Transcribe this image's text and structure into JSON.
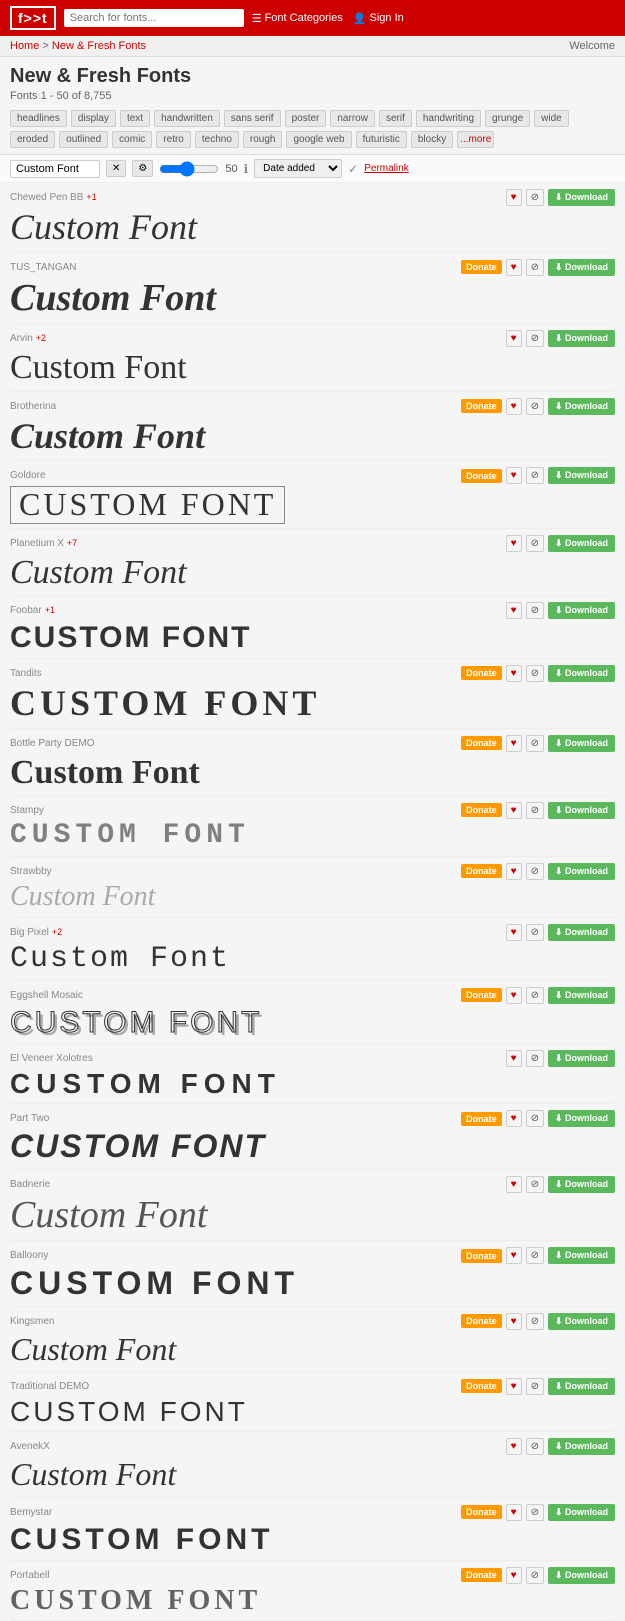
{
  "header": {
    "logo": "f>>t",
    "search_placeholder": "Search for fonts...",
    "nav": [
      {
        "label": "Font Categories",
        "icon": "menu-icon"
      },
      {
        "label": "Sign In",
        "icon": "user-icon"
      }
    ]
  },
  "breadcrumb": {
    "home": "Home",
    "section": "New & Fresh Fonts",
    "welcome": "Welcome"
  },
  "page": {
    "title": "New & Fresh Fonts",
    "subtitle": "Fonts 1 - 50 of 8,755"
  },
  "tags": [
    {
      "label": "headlines",
      "active": false
    },
    {
      "label": "display",
      "active": false
    },
    {
      "label": "text",
      "active": false
    },
    {
      "label": "handwritten",
      "active": false
    },
    {
      "label": "sans serif",
      "active": false
    },
    {
      "label": "poster",
      "active": false
    },
    {
      "label": "narrow",
      "active": false
    },
    {
      "label": "serif",
      "active": false
    },
    {
      "label": "handwriting",
      "active": false
    },
    {
      "label": "grunge",
      "active": false
    },
    {
      "label": "wide",
      "active": false
    },
    {
      "label": "eroded",
      "active": false
    },
    {
      "label": "outlined",
      "active": false
    },
    {
      "label": "comic",
      "active": false
    },
    {
      "label": "retro",
      "active": false
    },
    {
      "label": "techno",
      "active": false
    },
    {
      "label": "rough",
      "active": false
    },
    {
      "label": "google web",
      "active": false
    },
    {
      "label": "futuristic",
      "active": false
    },
    {
      "label": "blocky",
      "active": false
    },
    {
      "label": "...more",
      "active": false,
      "special": true
    }
  ],
  "controls": {
    "preview_text": "Custom Font",
    "size": "50",
    "sort": "Date added",
    "permalink": "Permalink"
  },
  "fonts": [
    {
      "name": "Chewed Pen BB",
      "variant": "+1",
      "preview": "Custom Font",
      "style": "chewed",
      "donate": false,
      "heart": true,
      "block": true
    },
    {
      "name": "TUS_TANGAN",
      "variant": "",
      "preview": "Custom Font",
      "style": "tangan",
      "donate": true,
      "heart": true,
      "block": true
    },
    {
      "name": "Arvin",
      "variant": "+2",
      "preview": "Custom Font",
      "style": "arvin",
      "donate": false,
      "heart": true,
      "block": true
    },
    {
      "name": "Brotherina",
      "variant": "",
      "preview": "Custom Font",
      "style": "brotherina",
      "donate": true,
      "heart": true,
      "block": true
    },
    {
      "name": "Goldore",
      "variant": "",
      "preview": "CUSTOM FONT",
      "style": "goldore",
      "donate": true,
      "heart": true,
      "block": true
    },
    {
      "name": "Planetium X",
      "variant": "+7",
      "preview": "Custom Font",
      "style": "planetium",
      "donate": false,
      "heart": true,
      "block": true
    },
    {
      "name": "Foobar",
      "variant": "+1",
      "preview": "CUSTOM FONT",
      "style": "foobar",
      "donate": false,
      "heart": true,
      "block": true
    },
    {
      "name": "Tandits",
      "variant": "",
      "preview": "CUSTOM FONT",
      "style": "tandits",
      "donate": true,
      "heart": true,
      "block": true
    },
    {
      "name": "Bottle Party DEMO",
      "variant": "",
      "preview": "Custom Font",
      "style": "bottleparty",
      "donate": true,
      "heart": true,
      "block": true
    },
    {
      "name": "Stampy",
      "variant": "",
      "preview": "CUSTOM FONT",
      "style": "stampy",
      "donate": true,
      "heart": true,
      "block": true
    },
    {
      "name": "Strawbby",
      "variant": "",
      "preview": "Custom Font",
      "style": "strawbby",
      "donate": true,
      "heart": true,
      "block": true
    },
    {
      "name": "Big Pixel",
      "variant": "+2",
      "preview": "Custom Font",
      "style": "bigpixel",
      "donate": false,
      "heart": true,
      "block": true
    },
    {
      "name": "Eggshell Mosaic",
      "variant": "",
      "preview": "CUSTOM FONT",
      "style": "eggshell",
      "donate": true,
      "heart": true,
      "block": true
    },
    {
      "name": "El Veneer Xolotres",
      "variant": "",
      "preview": "CUSTOM FONT",
      "style": "elvenin",
      "donate": false,
      "heart": true,
      "block": true
    },
    {
      "name": "Part Two",
      "variant": "",
      "preview": "CUSTOM FONT",
      "style": "parttwo",
      "donate": true,
      "heart": true,
      "block": true
    },
    {
      "name": "Badnerie",
      "variant": "",
      "preview": "Custom Font",
      "style": "badnerie",
      "donate": false,
      "heart": true,
      "block": true
    },
    {
      "name": "Balloony",
      "variant": "",
      "preview": "CUSTOM FONT",
      "style": "balloony",
      "donate": true,
      "heart": true,
      "block": true
    },
    {
      "name": "Kingsmen",
      "variant": "",
      "preview": "Custom Font",
      "style": "kingsmen",
      "donate": true,
      "heart": true,
      "block": true
    },
    {
      "name": "Traditional DEMO",
      "variant": "",
      "preview": "CUSTOM FONT",
      "style": "traditional",
      "donate": true,
      "heart": true,
      "block": true
    },
    {
      "name": "AvenekX",
      "variant": "",
      "preview": "Custom Font",
      "style": "avenek",
      "donate": false,
      "heart": true,
      "block": true
    },
    {
      "name": "Bemystar",
      "variant": "",
      "preview": "CUSTOM FONT",
      "style": "bemystar",
      "donate": true,
      "heart": true,
      "block": true
    },
    {
      "name": "Portabell",
      "variant": "",
      "preview": "CUSTOM FONT",
      "style": "portabell",
      "donate": true,
      "heart": true,
      "block": true
    }
  ],
  "buttons": {
    "donate": "Donate",
    "download": "Download",
    "heart_symbol": "♥",
    "block_symbol": "⊘"
  }
}
